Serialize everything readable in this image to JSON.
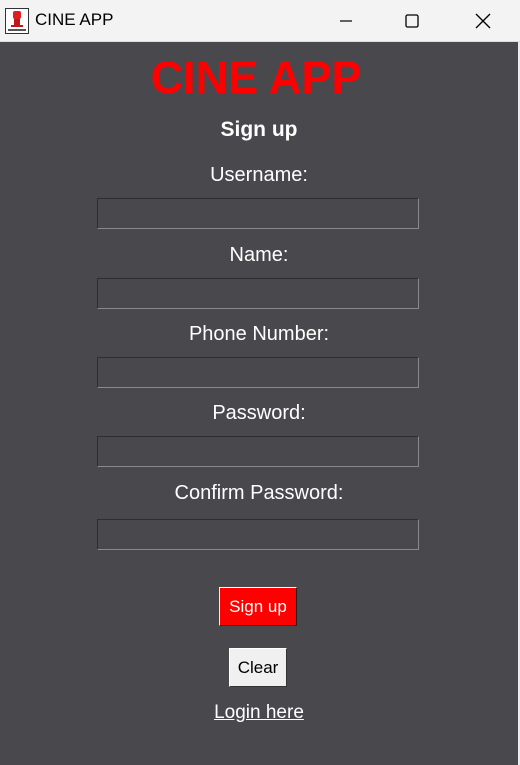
{
  "window": {
    "title": "CINE APP",
    "icon": "cinema-app-icon",
    "controls": {
      "minimize_icon": "minimize-icon",
      "maximize_icon": "maximize-icon",
      "close_icon": "close-icon"
    }
  },
  "form": {
    "heading": "CINE APP",
    "subheading": "Sign up",
    "fields": [
      {
        "label": "Username:",
        "value": "",
        "placeholder": ""
      },
      {
        "label": "Name:",
        "value": "",
        "placeholder": ""
      },
      {
        "label": "Phone Number:",
        "value": "",
        "placeholder": ""
      },
      {
        "label": "Password:",
        "value": "",
        "placeholder": ""
      },
      {
        "label": "Confirm Password:",
        "value": "",
        "placeholder": ""
      }
    ],
    "signup_label": "Sign up",
    "clear_label": "Clear",
    "login_link": "Login here"
  },
  "colors": {
    "background": "#48484d",
    "accent": "#ff0000",
    "text": "#ffffff"
  }
}
